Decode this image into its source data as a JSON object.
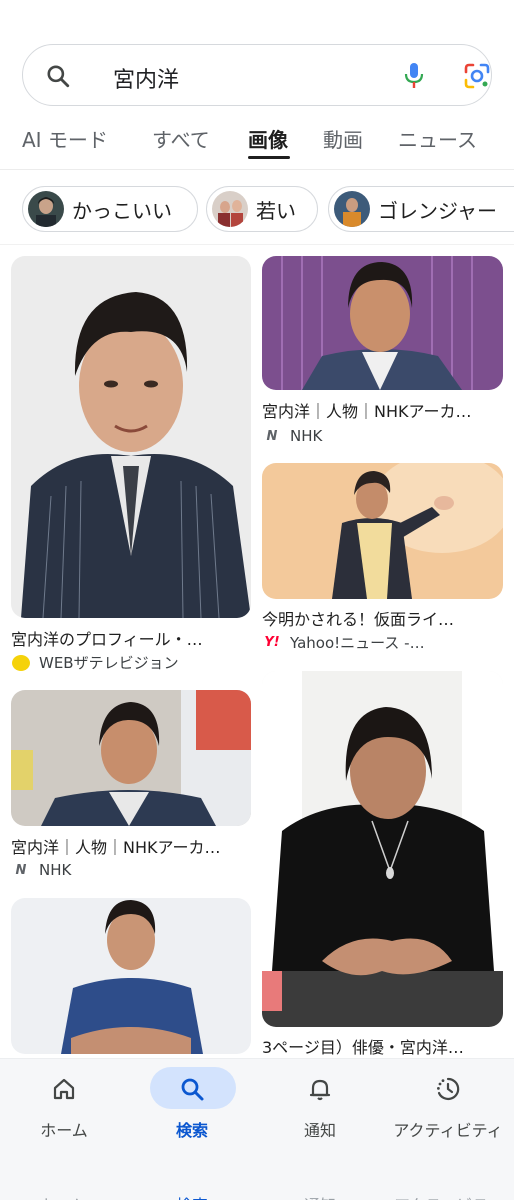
{
  "search": {
    "query": "宮内洋"
  },
  "tabs": [
    {
      "label": "AI モード",
      "active": false
    },
    {
      "label": "すべて",
      "active": false
    },
    {
      "label": "画像",
      "active": true
    },
    {
      "label": "動画",
      "active": false
    },
    {
      "label": "ニュース",
      "active": false
    }
  ],
  "chips": [
    {
      "label": "かっこいい"
    },
    {
      "label": "若い"
    },
    {
      "label": "ゴレンジャー"
    }
  ],
  "results": [
    {
      "title": "宮内洋のプロフィール・…",
      "source": "WEBザテレビジョン",
      "favicon": "webtv-icon"
    },
    {
      "title": "宮内洋｜人物｜NHKアーカ…",
      "source": "NHK",
      "favicon": "nhk-icon"
    },
    {
      "title": "今明かされる！仮面ライ…",
      "source": "Yahoo!ニュース -…",
      "favicon": "yahoo-icon"
    },
    {
      "title": "宮内洋｜人物｜NHKアーカ…",
      "source": "NHK",
      "favicon": "nhk-icon"
    },
    {
      "title": "3ページ目）俳優・宮内洋…",
      "source": "",
      "favicon": ""
    },
    {
      "title": "",
      "source": "",
      "favicon": ""
    }
  ],
  "nav": [
    {
      "label": "ホーム",
      "icon": "home-icon",
      "active": false
    },
    {
      "label": "検索",
      "icon": "search-icon",
      "active": true
    },
    {
      "label": "通知",
      "icon": "bell-icon",
      "active": false
    },
    {
      "label": "アクティビティ",
      "icon": "activity-icon",
      "active": false
    }
  ],
  "colors": {
    "accent": "#0b57d0",
    "active_pill": "#d3e3fd",
    "nav_bg": "#f6f7f9"
  }
}
